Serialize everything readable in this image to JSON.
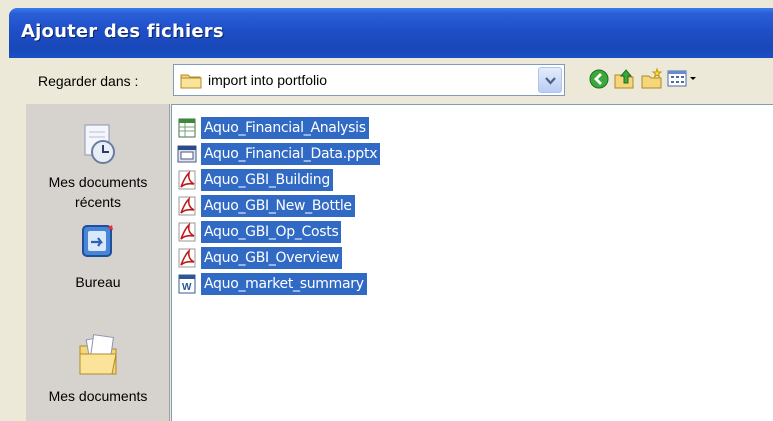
{
  "dialog": {
    "title": "Ajouter des fichiers"
  },
  "lookin": {
    "label": "Regarder dans :",
    "value": "import into portfolio",
    "folder_icon": "folder-icon"
  },
  "toolbar": {
    "back_icon": "back-icon",
    "up_icon": "up-folder-icon",
    "new_folder_icon": "new-folder-icon",
    "view_icon": "view-menu-icon"
  },
  "places": [
    {
      "label": "Mes documents récents",
      "icon": "recent-documents-icon"
    },
    {
      "label": "Bureau",
      "icon": "desktop-icon"
    },
    {
      "label": "Mes documents",
      "icon": "my-documents-icon"
    }
  ],
  "files": [
    {
      "name": "Aquo_Financial_Analysis",
      "icon": "excel-file-icon"
    },
    {
      "name": "Aquo_Financial_Data.pptx",
      "icon": "generic-file-icon"
    },
    {
      "name": "Aquo_GBI_Building",
      "icon": "pdf-file-icon"
    },
    {
      "name": "Aquo_GBI_New_Bottle",
      "icon": "pdf-file-icon"
    },
    {
      "name": "Aquo_GBI_Op_Costs",
      "icon": "pdf-file-icon"
    },
    {
      "name": "Aquo_GBI_Overview",
      "icon": "pdf-file-icon"
    },
    {
      "name": "Aquo_market_summary",
      "icon": "word-file-icon"
    }
  ],
  "colors": {
    "titlebar": "#1f4fc7",
    "selection": "#316ac5",
    "window_bg": "#ece9d8"
  }
}
